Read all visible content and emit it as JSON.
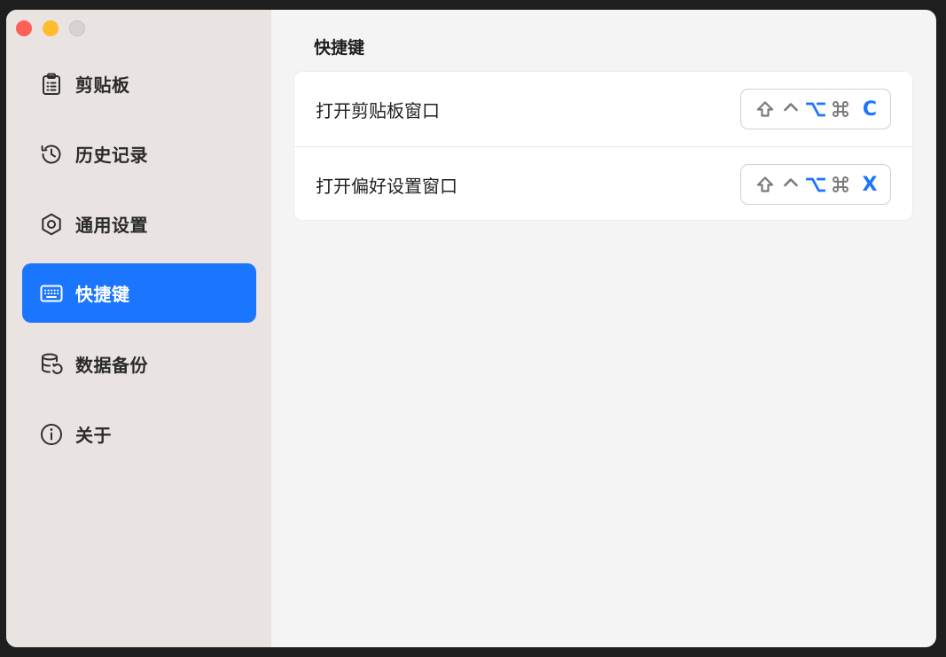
{
  "sidebar": {
    "items": [
      {
        "label": "剪贴板",
        "icon": "clipboard-icon",
        "active": false
      },
      {
        "label": "历史记录",
        "icon": "history-icon",
        "active": false
      },
      {
        "label": "通用设置",
        "icon": "settings-icon",
        "active": false
      },
      {
        "label": "快捷键",
        "icon": "keyboard-icon",
        "active": true
      },
      {
        "label": "数据备份",
        "icon": "backup-icon",
        "active": false
      },
      {
        "label": "关于",
        "icon": "info-icon",
        "active": false
      }
    ]
  },
  "main": {
    "title": "快捷键",
    "shortcuts": [
      {
        "label": "打开剪贴板窗口",
        "modifiers": {
          "shift": false,
          "control": false,
          "option": true,
          "command": false
        },
        "key": "C"
      },
      {
        "label": "打开偏好设置窗口",
        "modifiers": {
          "shift": false,
          "control": false,
          "option": true,
          "command": false
        },
        "key": "X"
      }
    ]
  },
  "colors": {
    "accent": "#1a75ff",
    "sidebar_bg": "#e9e4e1",
    "content_bg": "#f4f4f4"
  }
}
